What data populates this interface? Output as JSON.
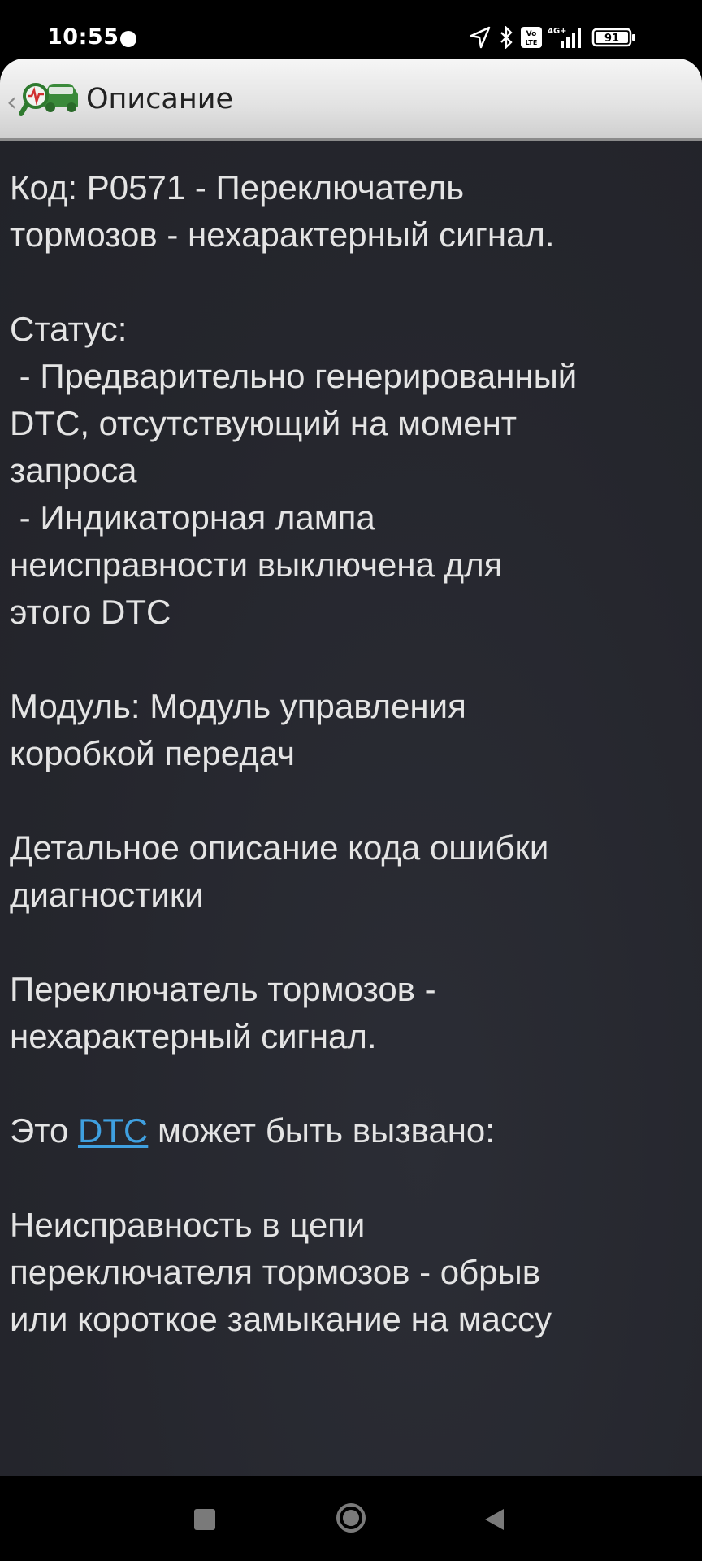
{
  "status_bar": {
    "time": "10:55",
    "battery": "91",
    "network": "4G+",
    "volte": "Vo LTE"
  },
  "app_bar": {
    "title": "Описание"
  },
  "content": {
    "code_line": "Код: P0571 - Переключатель\nтормозов - нехарактерный сигнал.",
    "status_label": "Статус:",
    "status_item_1": " - Предварительно генерированный\nDTC, отсутствующий на момент\nзапроса",
    "status_item_2": " - Индикаторная лампа\nнеисправности выключена для\nэтого DTC",
    "module_line": "Модуль: Модуль управления\nкоробкой передач",
    "detail_heading": "Детальное описание кода ошибки\nдиагностики",
    "detail_text": "Переключатель тормозов -\nнехарактерный сигнал.",
    "cause_prefix": "Это ",
    "cause_link": "DTC",
    "cause_suffix": " может быть вызвано:",
    "cause_text": "Неисправность в цепи\nпереключателя тормозов - обрыв\nили короткое замыкание на массу"
  },
  "colors": {
    "background": "#25262d",
    "text": "#e4e4e4",
    "link": "#3fa0e0",
    "app_bar": "#e2e2e2"
  }
}
